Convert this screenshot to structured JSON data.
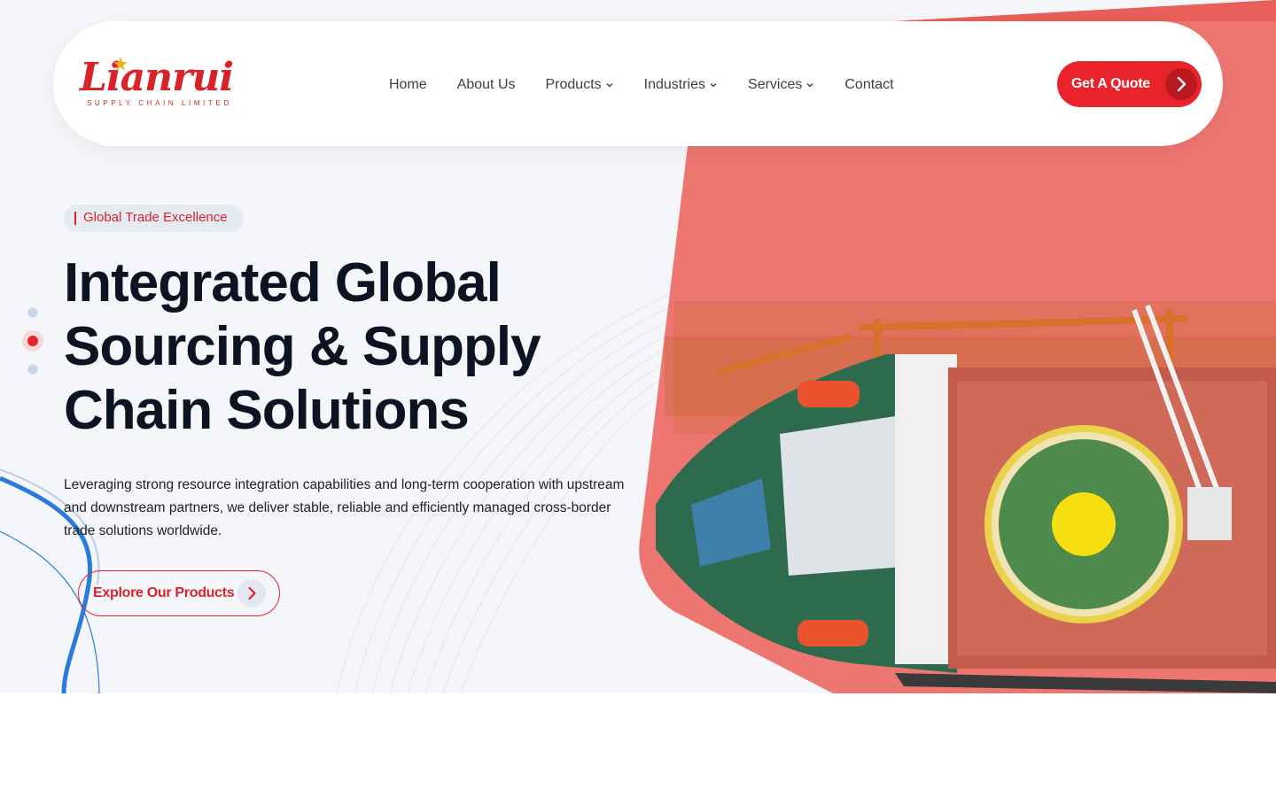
{
  "brand": {
    "name": "Lianrui",
    "subtitle": "SUPPLY CHAIN LIMITED",
    "logo_color": "#d9232a"
  },
  "nav": {
    "items": [
      {
        "label": "Home",
        "has_dropdown": false
      },
      {
        "label": "About Us",
        "has_dropdown": false
      },
      {
        "label": "Products",
        "has_dropdown": true
      },
      {
        "label": "Industries",
        "has_dropdown": true
      },
      {
        "label": "Services",
        "has_dropdown": true
      },
      {
        "label": "Contact",
        "has_dropdown": false
      }
    ],
    "cta_label": "Get A Quote"
  },
  "hero": {
    "tag": "Global Trade Excellence",
    "headline_lines": [
      "Integrated Global",
      "Sourcing & Supply",
      "Chain Solutions"
    ],
    "paragraph": "Leveraging strong resource integration capabilities and long-term cooperation with upstream and downstream partners, we deliver stable, reliable and efficiently managed cross-border trade solutions worldwide.",
    "button_label": "Explore Our Products",
    "slider_dots": 3,
    "active_dot": 1
  },
  "colors": {
    "accent_red": "#e8232b",
    "red_panel": "#ee7671",
    "heading": "#0c1323",
    "background": "#f4f6f9",
    "blue_line": "#2a7be0"
  },
  "icons": {
    "cta_arrow": "chevron-right-icon",
    "dropdown": "chevron-down-icon"
  }
}
